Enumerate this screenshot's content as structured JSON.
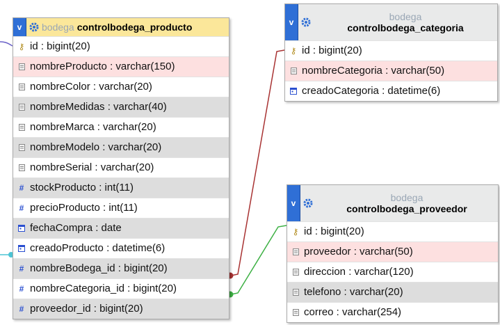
{
  "tables": [
    {
      "id": "producto",
      "toggle": "v",
      "db": "bodega",
      "name": "controlbodega_producto",
      "columns": [
        {
          "text": "id : bigint(20)",
          "icon": "key-icon",
          "bg": "white"
        },
        {
          "text": "nombreProducto : varchar(150)",
          "icon": "text-field-icon",
          "bg": "pink"
        },
        {
          "text": "nombreColor : varchar(20)",
          "icon": "text-field-icon",
          "bg": "white"
        },
        {
          "text": "nombreMedidas : varchar(40)",
          "icon": "text-field-icon",
          "bg": "gray"
        },
        {
          "text": "nombreMarca : varchar(20)",
          "icon": "text-field-icon",
          "bg": "white"
        },
        {
          "text": "nombreModelo : varchar(20)",
          "icon": "text-field-icon",
          "bg": "gray"
        },
        {
          "text": "nombreSerial : varchar(20)",
          "icon": "text-field-icon",
          "bg": "white"
        },
        {
          "text": "stockProducto : int(11)",
          "icon": "number-field-icon",
          "bg": "gray"
        },
        {
          "text": "precioProducto : int(11)",
          "icon": "number-field-icon",
          "bg": "white"
        },
        {
          "text": "fechaCompra : date",
          "icon": "date-field-icon",
          "bg": "gray"
        },
        {
          "text": "creadoProducto : datetime(6)",
          "icon": "date-field-icon",
          "bg": "white"
        },
        {
          "text": "nombreBodega_id : bigint(20)",
          "icon": "number-field-icon",
          "bg": "gray"
        },
        {
          "text": "nombreCategoria_id : bigint(20)",
          "icon": "number-field-icon",
          "bg": "white"
        },
        {
          "text": "proveedor_id : bigint(20)",
          "icon": "number-field-icon",
          "bg": "gray"
        }
      ]
    },
    {
      "id": "categoria",
      "toggle": "v",
      "db": "bodega",
      "name": "controlbodega_categoria",
      "columns": [
        {
          "text": "id : bigint(20)",
          "icon": "key-icon",
          "bg": "white"
        },
        {
          "text": "nombreCategoria : varchar(50)",
          "icon": "text-field-icon",
          "bg": "pink"
        },
        {
          "text": "creadoCategoria : datetime(6)",
          "icon": "date-field-icon",
          "bg": "white"
        }
      ]
    },
    {
      "id": "proveedor",
      "toggle": "v",
      "db": "bodega",
      "name": "controlbodega_proveedor",
      "columns": [
        {
          "text": "id : bigint(20)",
          "icon": "key-icon",
          "bg": "white"
        },
        {
          "text": "proveedor : varchar(50)",
          "icon": "text-field-icon",
          "bg": "pink"
        },
        {
          "text": "direccion : varchar(120)",
          "icon": "text-field-icon",
          "bg": "white"
        },
        {
          "text": "telefono : varchar(20)",
          "icon": "text-field-icon",
          "bg": "gray"
        },
        {
          "text": "correo : varchar(254)",
          "icon": "text-field-icon",
          "bg": "white"
        }
      ]
    }
  ],
  "relations": [
    {
      "from": "producto.nombreCategoria_id",
      "to": "categoria.id",
      "color": "#a83232"
    },
    {
      "from": "producto.proveedor_id",
      "to": "proveedor.id",
      "color": "#3cb043"
    }
  ],
  "colors": {
    "header_single": "#fbe79a",
    "header_two": "#e9eaea",
    "toggle": "#2f6fd6",
    "row_pink": "#fde0e0",
    "row_gray": "#dddddd"
  }
}
